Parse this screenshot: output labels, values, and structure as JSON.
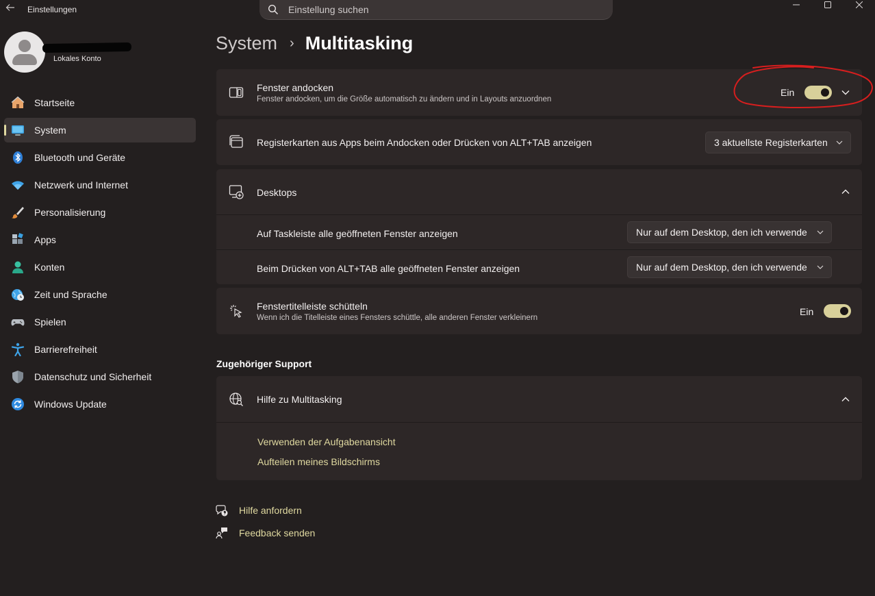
{
  "app": {
    "title": "Einstellungen",
    "back_icon": "back-arrow-icon",
    "window_controls": [
      "minimize-icon",
      "maximize-icon",
      "close-icon"
    ]
  },
  "search": {
    "placeholder": "Einstellung suchen",
    "icon": "search-icon"
  },
  "account": {
    "type": "Lokales Konto"
  },
  "sidebar": {
    "items": [
      {
        "label": "Startseite",
        "icon": "home-icon",
        "selected": false
      },
      {
        "label": "System",
        "icon": "system-monitor-icon",
        "selected": true
      },
      {
        "label": "Bluetooth und Geräte",
        "icon": "bluetooth-icon",
        "selected": false
      },
      {
        "label": "Netzwerk und Internet",
        "icon": "wifi-icon",
        "selected": false
      },
      {
        "label": "Personalisierung",
        "icon": "brush-icon",
        "selected": false
      },
      {
        "label": "Apps",
        "icon": "apps-icon",
        "selected": false
      },
      {
        "label": "Konten",
        "icon": "account-icon",
        "selected": false
      },
      {
        "label": "Zeit und Sprache",
        "icon": "globe-clock-icon",
        "selected": false
      },
      {
        "label": "Spielen",
        "icon": "gamepad-icon",
        "selected": false
      },
      {
        "label": "Barrierefreiheit",
        "icon": "accessibility-icon",
        "selected": false
      },
      {
        "label": "Datenschutz und Sicherheit",
        "icon": "shield-icon",
        "selected": false
      },
      {
        "label": "Windows Update",
        "icon": "update-icon",
        "selected": false
      }
    ]
  },
  "breadcrumb": {
    "parent": "System",
    "separator": "›",
    "current": "Multitasking"
  },
  "settings": {
    "snap": {
      "title": "Fenster andocken",
      "description": "Fenster andocken, um die Größe automatisch zu ändern und in Layouts anzuordnen",
      "toggle_label": "Ein",
      "toggle_on": true
    },
    "tabs": {
      "title": "Registerkarten aus Apps beim Andocken oder Drücken von ALT+TAB anzeigen",
      "dropdown_value": "3 aktuellste Registerkarten"
    },
    "desktops": {
      "title": "Desktops",
      "taskbar_label": "Auf Taskleiste alle geöffneten Fenster anzeigen",
      "taskbar_value": "Nur auf dem Desktop, den ich verwende",
      "alttab_label": "Beim Drücken von ALT+TAB alle geöffneten Fenster anzeigen",
      "alttab_value": "Nur auf dem Desktop, den ich verwende"
    },
    "shake": {
      "title": "Fenstertitelleiste schütteln",
      "description": "Wenn ich die Titelleiste eines Fensters schüttle, alle anderen Fenster verkleinern",
      "toggle_label": "Ein",
      "toggle_on": true
    }
  },
  "support": {
    "section_title": "Zugehöriger Support",
    "help_title": "Hilfe zu Multitasking",
    "links": [
      "Verwenden der Aufgabenansicht",
      "Aufteilen meines Bildschirms"
    ]
  },
  "footer": {
    "get_help": "Hilfe anfordern",
    "feedback": "Feedback senden"
  },
  "colors": {
    "background": "#231f1f",
    "card": "#2d2727",
    "accent": "#e0d9a0",
    "toggle_on": "#d8d09a",
    "annotation": "#d81e1e"
  }
}
